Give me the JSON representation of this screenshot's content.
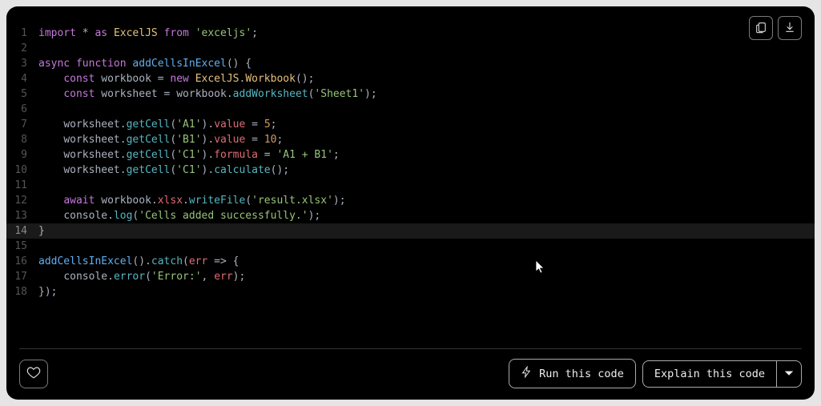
{
  "toolbar": {
    "copy_title": "Copy",
    "download_title": "Download"
  },
  "code": {
    "highlight_line": 14,
    "lines": [
      [
        {
          "t": "import",
          "c": "kw"
        },
        {
          "t": " ",
          "c": "plain"
        },
        {
          "t": "*",
          "c": "punc"
        },
        {
          "t": " ",
          "c": "plain"
        },
        {
          "t": "as",
          "c": "kw"
        },
        {
          "t": " ",
          "c": "plain"
        },
        {
          "t": "ExcelJS",
          "c": "cls"
        },
        {
          "t": " ",
          "c": "plain"
        },
        {
          "t": "from",
          "c": "kw"
        },
        {
          "t": " ",
          "c": "plain"
        },
        {
          "t": "'exceljs'",
          "c": "str"
        },
        {
          "t": ";",
          "c": "punc"
        }
      ],
      [],
      [
        {
          "t": "async",
          "c": "kw"
        },
        {
          "t": " ",
          "c": "plain"
        },
        {
          "t": "function",
          "c": "kw"
        },
        {
          "t": " ",
          "c": "plain"
        },
        {
          "t": "addCellsInExcel",
          "c": "fn"
        },
        {
          "t": "() {",
          "c": "punc"
        }
      ],
      [
        {
          "t": "    ",
          "c": "plain"
        },
        {
          "t": "const",
          "c": "kw"
        },
        {
          "t": " ",
          "c": "plain"
        },
        {
          "t": "workbook",
          "c": "plain"
        },
        {
          "t": " = ",
          "c": "punc"
        },
        {
          "t": "new",
          "c": "kw"
        },
        {
          "t": " ",
          "c": "plain"
        },
        {
          "t": "ExcelJS",
          "c": "cls"
        },
        {
          "t": ".",
          "c": "punc"
        },
        {
          "t": "Workbook",
          "c": "cls"
        },
        {
          "t": "();",
          "c": "punc"
        }
      ],
      [
        {
          "t": "    ",
          "c": "plain"
        },
        {
          "t": "const",
          "c": "kw"
        },
        {
          "t": " ",
          "c": "plain"
        },
        {
          "t": "worksheet",
          "c": "plain"
        },
        {
          "t": " = ",
          "c": "punc"
        },
        {
          "t": "workbook",
          "c": "plain"
        },
        {
          "t": ".",
          "c": "punc"
        },
        {
          "t": "addWorksheet",
          "c": "meth"
        },
        {
          "t": "(",
          "c": "punc"
        },
        {
          "t": "'Sheet1'",
          "c": "str"
        },
        {
          "t": ");",
          "c": "punc"
        }
      ],
      [],
      [
        {
          "t": "    ",
          "c": "plain"
        },
        {
          "t": "worksheet",
          "c": "plain"
        },
        {
          "t": ".",
          "c": "punc"
        },
        {
          "t": "getCell",
          "c": "meth"
        },
        {
          "t": "(",
          "c": "punc"
        },
        {
          "t": "'A1'",
          "c": "str"
        },
        {
          "t": ").",
          "c": "punc"
        },
        {
          "t": "value",
          "c": "prop"
        },
        {
          "t": " = ",
          "c": "punc"
        },
        {
          "t": "5",
          "c": "num"
        },
        {
          "t": ";",
          "c": "punc"
        }
      ],
      [
        {
          "t": "    ",
          "c": "plain"
        },
        {
          "t": "worksheet",
          "c": "plain"
        },
        {
          "t": ".",
          "c": "punc"
        },
        {
          "t": "getCell",
          "c": "meth"
        },
        {
          "t": "(",
          "c": "punc"
        },
        {
          "t": "'B1'",
          "c": "str"
        },
        {
          "t": ").",
          "c": "punc"
        },
        {
          "t": "value",
          "c": "prop"
        },
        {
          "t": " = ",
          "c": "punc"
        },
        {
          "t": "10",
          "c": "num"
        },
        {
          "t": ";",
          "c": "punc"
        }
      ],
      [
        {
          "t": "    ",
          "c": "plain"
        },
        {
          "t": "worksheet",
          "c": "plain"
        },
        {
          "t": ".",
          "c": "punc"
        },
        {
          "t": "getCell",
          "c": "meth"
        },
        {
          "t": "(",
          "c": "punc"
        },
        {
          "t": "'C1'",
          "c": "str"
        },
        {
          "t": ").",
          "c": "punc"
        },
        {
          "t": "formula",
          "c": "prop"
        },
        {
          "t": " = ",
          "c": "punc"
        },
        {
          "t": "'A1 + B1'",
          "c": "str"
        },
        {
          "t": ";",
          "c": "punc"
        }
      ],
      [
        {
          "t": "    ",
          "c": "plain"
        },
        {
          "t": "worksheet",
          "c": "plain"
        },
        {
          "t": ".",
          "c": "punc"
        },
        {
          "t": "getCell",
          "c": "meth"
        },
        {
          "t": "(",
          "c": "punc"
        },
        {
          "t": "'C1'",
          "c": "str"
        },
        {
          "t": ").",
          "c": "punc"
        },
        {
          "t": "calculate",
          "c": "meth"
        },
        {
          "t": "();",
          "c": "punc"
        }
      ],
      [],
      [
        {
          "t": "    ",
          "c": "plain"
        },
        {
          "t": "await",
          "c": "kw"
        },
        {
          "t": " ",
          "c": "plain"
        },
        {
          "t": "workbook",
          "c": "plain"
        },
        {
          "t": ".",
          "c": "punc"
        },
        {
          "t": "xlsx",
          "c": "prop"
        },
        {
          "t": ".",
          "c": "punc"
        },
        {
          "t": "writeFile",
          "c": "meth"
        },
        {
          "t": "(",
          "c": "punc"
        },
        {
          "t": "'result.xlsx'",
          "c": "str"
        },
        {
          "t": ");",
          "c": "punc"
        }
      ],
      [
        {
          "t": "    ",
          "c": "plain"
        },
        {
          "t": "console",
          "c": "plain"
        },
        {
          "t": ".",
          "c": "punc"
        },
        {
          "t": "log",
          "c": "meth"
        },
        {
          "t": "(",
          "c": "punc"
        },
        {
          "t": "'Cells added successfully.'",
          "c": "str"
        },
        {
          "t": ");",
          "c": "punc"
        }
      ],
      [
        {
          "t": "}",
          "c": "punc"
        }
      ],
      [],
      [
        {
          "t": "addCellsInExcel",
          "c": "fn"
        },
        {
          "t": "().",
          "c": "punc"
        },
        {
          "t": "catch",
          "c": "meth"
        },
        {
          "t": "(",
          "c": "punc"
        },
        {
          "t": "err",
          "c": "var"
        },
        {
          "t": " ",
          "c": "plain"
        },
        {
          "t": "=>",
          "c": "punc"
        },
        {
          "t": " {",
          "c": "punc"
        }
      ],
      [
        {
          "t": "    ",
          "c": "plain"
        },
        {
          "t": "console",
          "c": "plain"
        },
        {
          "t": ".",
          "c": "punc"
        },
        {
          "t": "error",
          "c": "meth"
        },
        {
          "t": "(",
          "c": "punc"
        },
        {
          "t": "'Error:'",
          "c": "str"
        },
        {
          "t": ", ",
          "c": "punc"
        },
        {
          "t": "err",
          "c": "var"
        },
        {
          "t": ");",
          "c": "punc"
        }
      ],
      [
        {
          "t": "});",
          "c": "punc"
        }
      ]
    ]
  },
  "footer": {
    "like_title": "Like",
    "run_label": "Run this code",
    "explain_label": "Explain this code"
  }
}
